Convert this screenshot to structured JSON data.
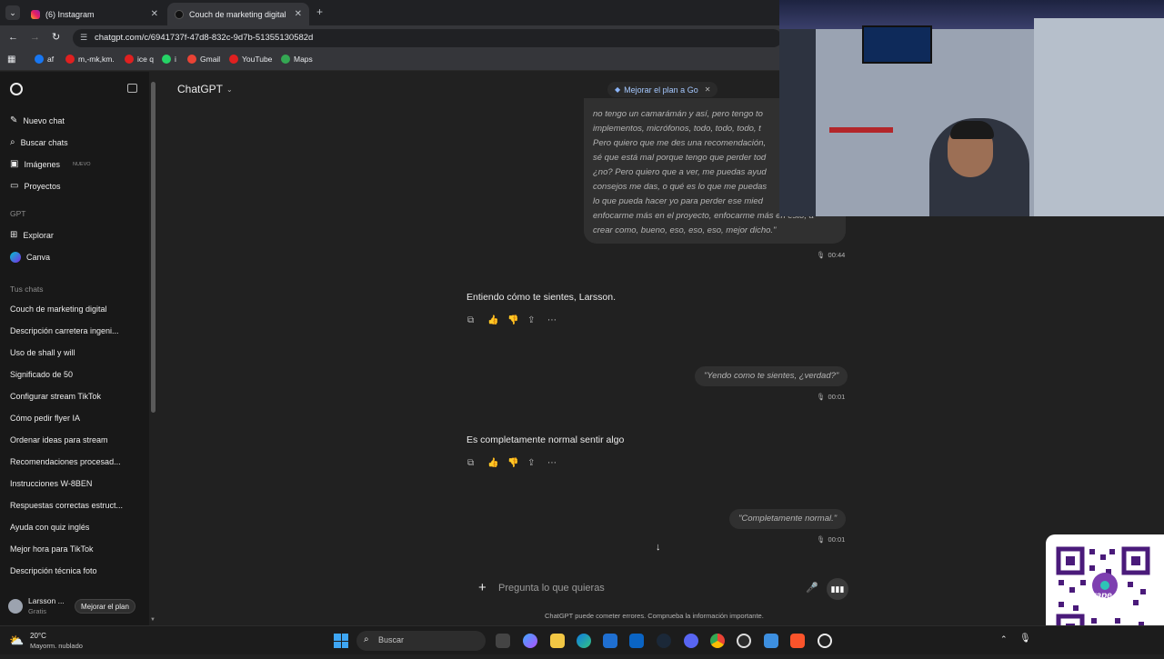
{
  "browser": {
    "tabs": [
      {
        "label": "(6) Instagram",
        "active": false
      },
      {
        "label": "Couch de marketing digital",
        "active": true
      }
    ],
    "url": "chatgpt.com/c/6941737f-47d8-832c-9d7b-51355130582d",
    "bookmarks": [
      {
        "label": "af",
        "color": "#1877f2"
      },
      {
        "label": "m,-mk,km.",
        "color": "#e02020"
      },
      {
        "label": "ice q",
        "color": "#e02020"
      },
      {
        "label": "i",
        "color": "#25d366"
      },
      {
        "label": "Gmail",
        "color": "#ea4335"
      },
      {
        "label": "YouTube",
        "color": "#e02020"
      },
      {
        "label": "Maps",
        "color": "#34a853"
      }
    ]
  },
  "sidebar": {
    "top_items": [
      {
        "label": "Nuevo chat",
        "icon": "edit-icon"
      },
      {
        "label": "Buscar chats",
        "icon": "search-icon"
      },
      {
        "label": "Imágenes",
        "icon": "image-icon",
        "badge": "NUEVO"
      },
      {
        "label": "Proyectos",
        "icon": "folder-icon"
      }
    ],
    "gpt_section": "GPT",
    "gpt_items": [
      {
        "label": "Explorar",
        "icon": "grid-icon"
      },
      {
        "label": "Canva",
        "icon": "canva-icon"
      }
    ],
    "chats_section": "Tus chats",
    "chats": [
      "Couch de marketing digital",
      "Descripción carretera ingeni...",
      "Uso de shall y will",
      "Significado de 50",
      "Configurar stream TikTok",
      "Cómo pedir flyer IA",
      "Ordenar ideas para stream",
      "Recomendaciones procesad...",
      "Instrucciones W-8BEN",
      "Respuestas correctas estruct...",
      "Ayuda con quiz inglés",
      "Mejor hora para TikTok",
      "Descripción técnica foto"
    ],
    "user": {
      "name": "Larsson ...",
      "plan": "Gratis",
      "initial": "L",
      "upgrade": "Mejorar el plan"
    }
  },
  "header": {
    "model": "ChatGPT",
    "upgrade_pill": "Mejorar el plan a Go"
  },
  "messages": {
    "user1_lines": [
      "no tengo un camarámán y así, pero tengo to",
      "implementos, micrófonos, todo, todo, todo, t",
      "Pero quiero que me des una recomendación,",
      "sé que está mal porque tengo que perder tod",
      "¿no? Pero quiero que a ver, me puedas ayud",
      "consejos me das, o qué es lo que me puedas",
      "lo que pueda hacer yo para perder ese mied",
      "enfocarme más en el proyecto, enfocarme más en esto, a",
      "crear como, bueno, eso, eso, eso, mejor dicho.\""
    ],
    "user1_time": "00:44",
    "assistant1": "Entiendo cómo te sientes, Larsson.",
    "user2": "\"Yendo como te sientes, ¿verdad?\"",
    "user2_time": "00:01",
    "assistant2": "Es completamente normal sentir algo",
    "user3": "\"Completamente normal.\"",
    "user3_time": "00:01"
  },
  "composer": {
    "placeholder": "Pregunta lo que quieras",
    "disclaimer": "ChatGPT puede cometer errores. Comprueba la información importante."
  },
  "taskbar": {
    "weather_temp": "20°C",
    "weather_desc": "Mayorm. nublado",
    "search_placeholder": "Buscar"
  },
  "overlay": {
    "qr_brand": "yape"
  }
}
